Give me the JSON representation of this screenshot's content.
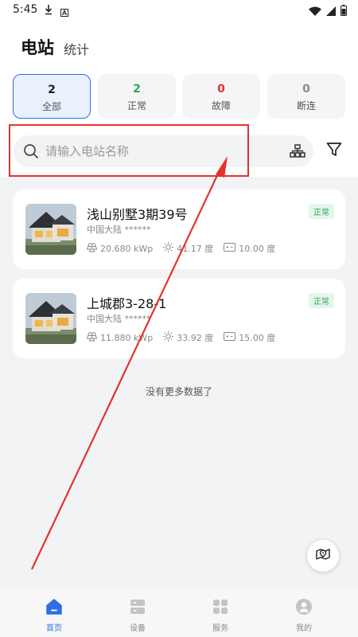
{
  "status_bar": {
    "time": "5:45"
  },
  "header": {
    "tabs": [
      {
        "label": "电站"
      },
      {
        "label": "统计"
      }
    ]
  },
  "filters": [
    {
      "count": "2",
      "label": "全部",
      "color": "#222222"
    },
    {
      "count": "2",
      "label": "正常",
      "color": "#2aa757"
    },
    {
      "count": "0",
      "label": "故障",
      "color": "#e5322d"
    },
    {
      "count": "0",
      "label": "断连",
      "color": "#888888"
    }
  ],
  "search": {
    "placeholder": "请输入电站名称",
    "value": ""
  },
  "stations": [
    {
      "name": "浅山别墅3期39号",
      "location": "中国大陆 ******",
      "status": "正常",
      "capacity": "20.680 kWp",
      "energy": "41.17 度",
      "battery": "10.00 度"
    },
    {
      "name": "上城郡3-28-1",
      "location": "中国大陆 ******",
      "status": "正常",
      "capacity": "11.880 kWp",
      "energy": "33.92 度",
      "battery": "15.00 度"
    }
  ],
  "list_footer": "没有更多数据了",
  "bottom_nav": [
    {
      "label": "首页",
      "icon": "home-icon"
    },
    {
      "label": "设备",
      "icon": "device-icon"
    },
    {
      "label": "服务",
      "icon": "service-icon"
    },
    {
      "label": "我的",
      "icon": "profile-icon"
    }
  ],
  "colors": {
    "accent": "#2f6fe4",
    "normal": "#2aa757",
    "fault": "#e5322d",
    "annotation": "#e5322d"
  }
}
